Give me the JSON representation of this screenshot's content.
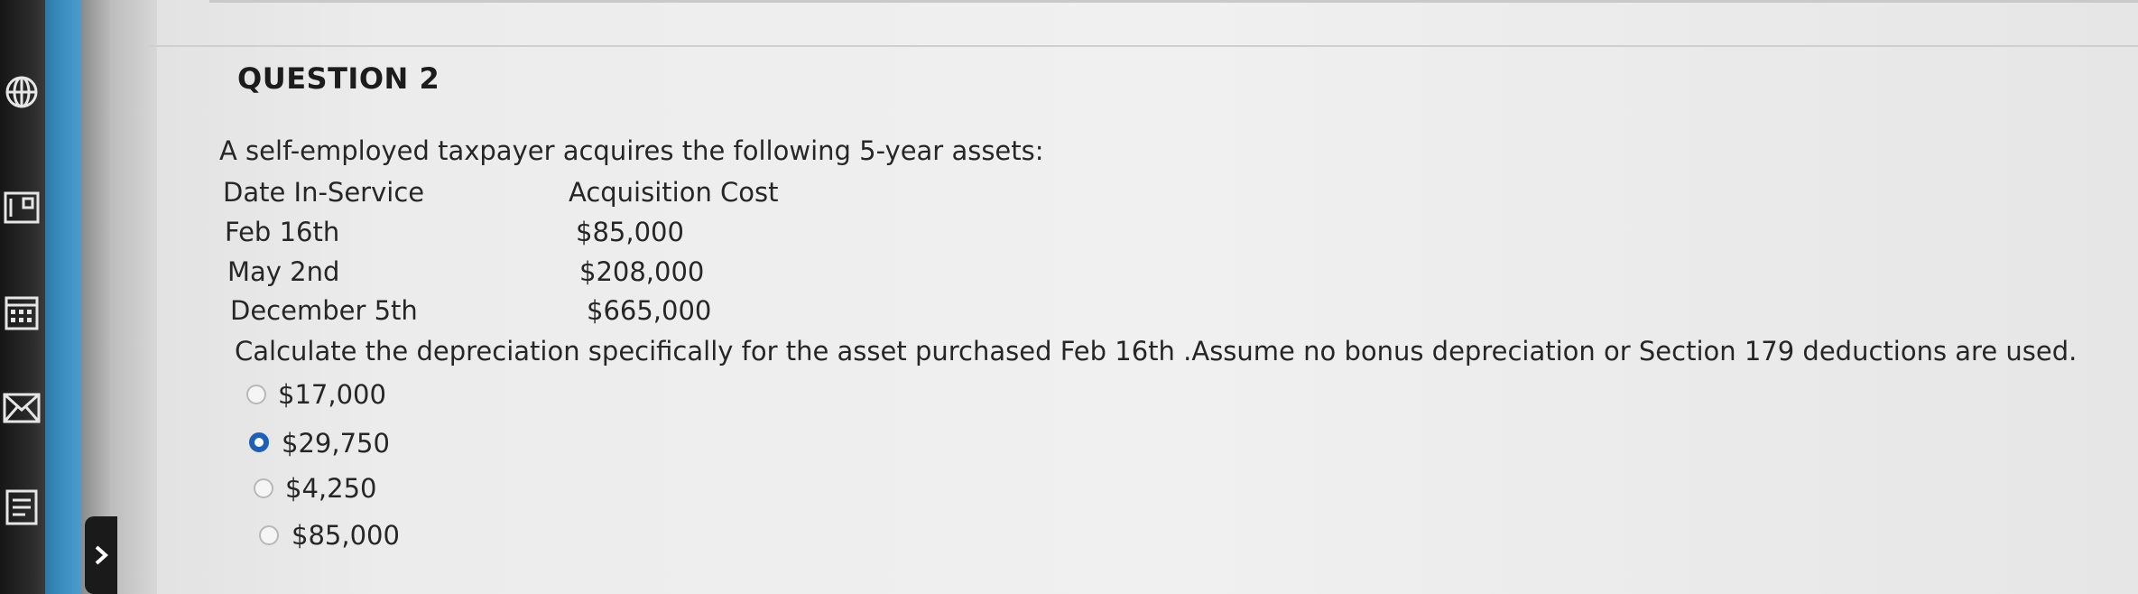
{
  "question": {
    "title": "QUESTION 2",
    "intro": "A self-employed taxpayer acquires the following 5-year assets:",
    "table": {
      "headers": [
        "Date In-Service",
        "Acquisition Cost"
      ],
      "rows": [
        [
          "Feb 16th",
          "$85,000"
        ],
        [
          "May 2nd",
          "$208,000"
        ],
        [
          "December 5th",
          "$665,000"
        ]
      ]
    },
    "prompt": "Calculate the depreciation specifically for the asset purchased Feb 16th .Assume no bonus depreciation or Section 179 deductions are used.",
    "options": [
      {
        "label": "$17,000",
        "selected": false
      },
      {
        "label": "$29,750",
        "selected": true
      },
      {
        "label": "$4,250",
        "selected": false
      },
      {
        "label": "$85,000",
        "selected": false
      }
    ]
  },
  "sidebar": {
    "icons": [
      "globe-icon",
      "panel-icon",
      "calendar-icon",
      "mail-icon",
      "notes-icon"
    ],
    "nav_arrow": "chevron-right-icon"
  },
  "colors": {
    "selected_radio": "#1f5fb5",
    "sidebar_blue": "#3a8fc0",
    "text": "#262626"
  }
}
